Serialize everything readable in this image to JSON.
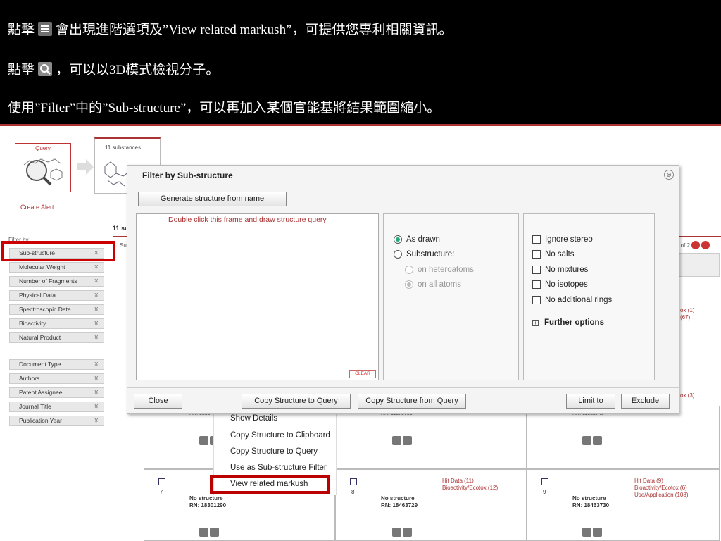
{
  "instructions": {
    "line1_pre": "點擊",
    "line1_post": "會出現進階選項及”View related markush”，可提供您專利相關資訊。",
    "line2_pre": "點擊",
    "line2_post": "，可以以3D模式檢視分子。",
    "line3": "使用”Filter”中的”Sub-structure”，可以再加入某個官能基將結果範圍縮小。"
  },
  "tabs": {
    "query_label": "Query",
    "substances_label": "11 substances"
  },
  "create_alert": "Create Alert",
  "filter_by": "Filter by",
  "sidebar": {
    "items": [
      "Sub-structure",
      "Molecular Weight",
      "Number of Fragments",
      "Physical Data",
      "Spectroscopic Data",
      "Bioactivity",
      "Natural Product",
      "Document Type",
      "Authors",
      "Patent Assignee",
      "Journal Title",
      "Publication Year"
    ]
  },
  "results": {
    "head": "11 su",
    "sub": "Sub",
    "pager": "1 of 2"
  },
  "dialog": {
    "title": "Filter by Sub-structure",
    "close_symbol": "⊗",
    "generate_button": "Generate structure from name",
    "draw_hint": "Double click this frame and draw structure query",
    "clear_button": "CLEAR",
    "match_options": {
      "as_drawn": "As drawn",
      "substructure": "Substructure:",
      "on_heteroatoms": "on heteroatoms",
      "on_all_atoms": "on all atoms"
    },
    "checkboxes": [
      "Ignore stereo",
      "No salts",
      "No mixtures",
      "No isotopes",
      "No additional rings"
    ],
    "further_options": "Further options",
    "buttons": {
      "close": "Close",
      "copy_to_query": "Copy Structure to Query",
      "copy_from_query": "Copy Structure from Query",
      "limit_to": "Limit to",
      "exclude": "Exclude"
    }
  },
  "context_menu": {
    "items": [
      "Show Details",
      "Copy Structure to Clipboard",
      "Copy Structure to Query",
      "Use as Sub-structure Filter",
      "View related markush"
    ]
  },
  "partial_side_hits": {
    "row1_a": "ox (1)",
    "row1_b": "(67)",
    "row2": "ox (3)"
  },
  "row2_rn": {
    "c1": "RN: 1833",
    "c2": "RN: 11375783",
    "c3": "RN: 11382749"
  },
  "cells": [
    {
      "num": "7",
      "structure": "No structure",
      "rn": "RN: 18301290",
      "hits": []
    },
    {
      "num": "8",
      "structure": "No structure",
      "rn": "RN: 18463729",
      "hits": [
        "Hit Data (11)",
        "Bioactivity/Ecotox (12)"
      ]
    },
    {
      "num": "9",
      "structure": "No structure",
      "rn": "RN: 18463730",
      "hits": [
        "Hit Data (9)",
        "Bioactivity/Ecotox (6)",
        "Use/Application (108)"
      ]
    }
  ],
  "colors": {
    "accent": "#aa3333",
    "highlight": "#cc0000",
    "radio_on": "#22aa77"
  }
}
